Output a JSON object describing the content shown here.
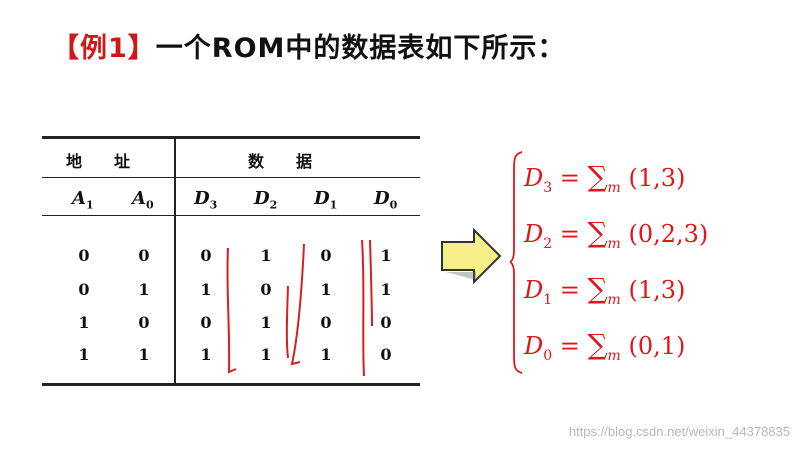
{
  "title": {
    "tag": "【例1】",
    "text": "一个ROM中的数据表如下所示："
  },
  "table": {
    "header_address": "地　　址",
    "header_data": "数　　据",
    "address_cols": [
      {
        "name": "A",
        "sub": "1"
      },
      {
        "name": "A",
        "sub": "0"
      }
    ],
    "data_cols": [
      {
        "name": "D",
        "sub": "3"
      },
      {
        "name": "D",
        "sub": "2"
      },
      {
        "name": "D",
        "sub": "1"
      },
      {
        "name": "D",
        "sub": "0"
      }
    ],
    "rows": [
      [
        "0",
        "0",
        "0",
        "1",
        "0",
        "1"
      ],
      [
        "0",
        "1",
        "1",
        "0",
        "1",
        "1"
      ],
      [
        "1",
        "0",
        "0",
        "1",
        "0",
        "0"
      ],
      [
        "1",
        "1",
        "1",
        "1",
        "1",
        "0"
      ]
    ]
  },
  "equations": [
    {
      "var": "D",
      "sub": "3",
      "eq": " = ",
      "sigma": "∑",
      "m": "m",
      "terms": " (1,3)"
    },
    {
      "var": "D",
      "sub": "2",
      "eq": " = ",
      "sigma": "∑",
      "m": "m",
      "terms": " (0,2,3)"
    },
    {
      "var": "D",
      "sub": "1",
      "eq": " = ",
      "sigma": "∑",
      "m": "m",
      "terms": " (1,3)"
    },
    {
      "var": "D",
      "sub": "0",
      "eq": " = ",
      "sigma": "∑",
      "m": "m",
      "terms": " (0,1)"
    }
  ],
  "watermark": "https://blog.csdn.net/weixin_44378835",
  "colors": {
    "red": "#e0161a",
    "arrow_fill": "#f7f08a",
    "ink": "#111111"
  }
}
